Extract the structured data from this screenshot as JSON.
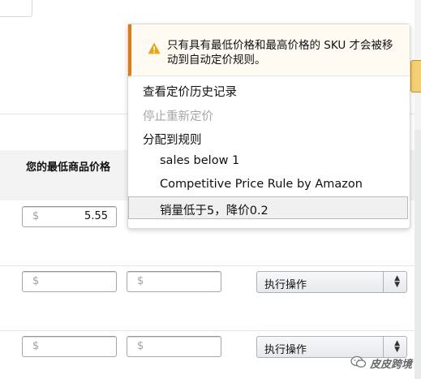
{
  "table": {
    "column_header": "您的最低商品价格",
    "rows": [
      {
        "min_price": {
          "currency": "$",
          "value": "5.55"
        }
      },
      {
        "min_price": {
          "currency": "$",
          "value": ""
        },
        "max_price": {
          "currency": "$",
          "value": ""
        },
        "action_label": "执行操作"
      },
      {
        "min_price": {
          "currency": "$",
          "value": ""
        },
        "max_price": {
          "currency": "$",
          "value": ""
        },
        "action_label": "执行操作"
      }
    ]
  },
  "dropdown": {
    "warning": "只有具有最低价格和最高价格的 SKU 才会被移动到自动定价规则。",
    "items": [
      {
        "label": "查看定价历史记录",
        "enabled": true
      },
      {
        "label": "停止重新定价",
        "enabled": false
      },
      {
        "label": "分配到规则",
        "enabled": true
      }
    ],
    "rules": [
      {
        "label": "sales below 1"
      },
      {
        "label": "Competitive Price Rule by Amazon"
      },
      {
        "label": "销量低于5，降价0.2",
        "highlighted": true
      }
    ]
  },
  "watermark": {
    "text": "皮皮跨境"
  },
  "colors": {
    "warning_accent": "#e47911",
    "warning_icon": "#f0a30a"
  }
}
